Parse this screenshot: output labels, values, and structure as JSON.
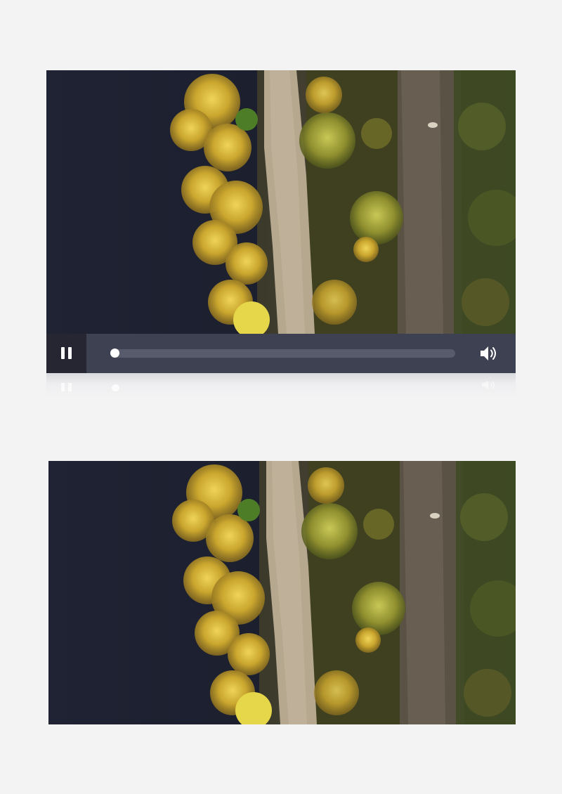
{
  "player": {
    "state": "playing",
    "play_pause_icon": "pause-icon",
    "volume_icon": "volume-icon",
    "progress_fraction": 0.0
  },
  "colors": {
    "page_background": "#f3f3f4",
    "control_bar": "#3e4152",
    "play_button_bg": "#252631",
    "progress_track": "#585b6c",
    "knob": "#ffffff",
    "water": "#1d2232",
    "foliage_yellow": "#d8b93a",
    "road": "#b7a890"
  }
}
